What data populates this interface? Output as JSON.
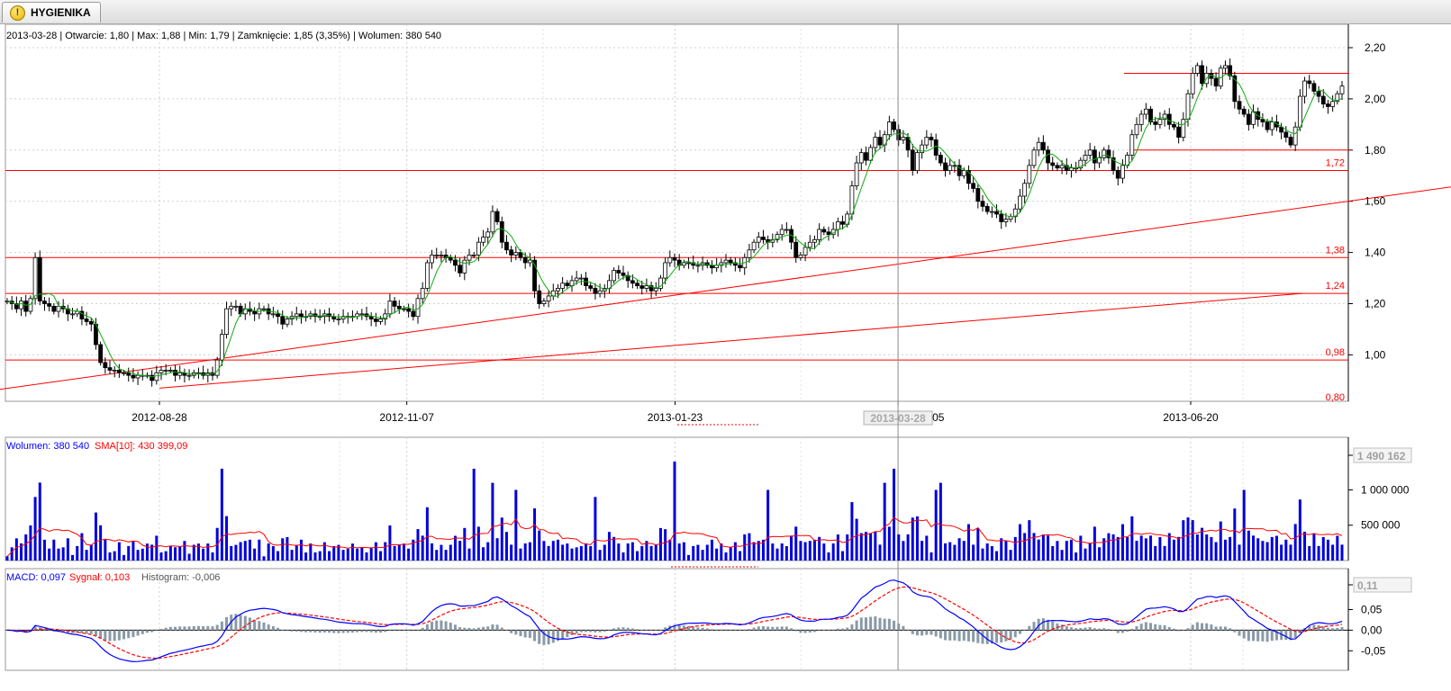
{
  "tab": {
    "title": "HYGIENIKA",
    "icon": "warning-icon"
  },
  "header": {
    "date": "2013-03-28",
    "info_text": "2013-03-28 | Otwarcie: 1,80 | Max: 1,88 | Min: 1,79 | Zamknięcie: 1,85 (3,35%)  | Wolumen: 380 540"
  },
  "volume_legend": {
    "volume": "Wolumen: 380 540",
    "sma": "SMA[10]: 430 399,09"
  },
  "macd_legend": {
    "macd": "MACD: 0,097",
    "signal": "Sygnał: 0,103",
    "histogram": "Histogram: -0,006"
  },
  "colors": {
    "up": "#ffffff",
    "down": "#000000",
    "sma_price": "#11aa11",
    "lines": "#ff0000",
    "volume": "#0000dd",
    "macd": "#0000ff",
    "signal": "#ff0000",
    "hist": "#8a9aa6"
  },
  "chart_data": [
    {
      "type": "candlestick",
      "title": "HYGIENIKA",
      "x_ticks": [
        "2012-08-28",
        "2012-11-07",
        "2013-01-23",
        "2013-03-28",
        "2013-06-20"
      ],
      "crosshair_date": "2013-03-28",
      "ylim": [
        0.84,
        2.22
      ],
      "y_ticks": [
        "2,20",
        "2,00",
        "1,80",
        "1,60",
        "1,40",
        "1,20",
        "1,00"
      ],
      "horizontal_levels": [
        {
          "value": 1.72,
          "label": "1,72"
        },
        {
          "value": 1.38,
          "label": "1,38"
        },
        {
          "value": 1.24,
          "label": "1,24"
        },
        {
          "value": 0.98,
          "label": "0,98"
        },
        {
          "value": 0.8,
          "label": "0,80"
        }
      ],
      "short_levels": [
        {
          "value": 2.1
        },
        {
          "value": 1.8
        }
      ],
      "trendlines": [
        {
          "from": [
            "2012-06-30",
            0.84
          ],
          "to": [
            "2013-09-10",
            1.67
          ]
        },
        {
          "from": [
            "2012-08-28",
            0.87
          ],
          "to": [
            "2013-07-22",
            1.24
          ]
        }
      ],
      "close": [
        1.21,
        1.2,
        1.18,
        1.21,
        1.17,
        1.22,
        1.38,
        1.21,
        1.2,
        1.19,
        1.17,
        1.19,
        1.18,
        1.16,
        1.16,
        1.17,
        1.14,
        1.13,
        1.12,
        1.04,
        0.97,
        0.95,
        0.94,
        0.94,
        0.93,
        0.93,
        0.92,
        0.91,
        0.92,
        0.92,
        0.92,
        0.9,
        0.93,
        0.94,
        0.94,
        0.94,
        0.92,
        0.93,
        0.92,
        0.92,
        0.93,
        0.93,
        0.92,
        0.93,
        0.92,
        0.98,
        1.08,
        1.18,
        1.19,
        1.19,
        1.16,
        1.18,
        1.17,
        1.16,
        1.18,
        1.18,
        1.16,
        1.16,
        1.15,
        1.12,
        1.14,
        1.15,
        1.16,
        1.15,
        1.15,
        1.16,
        1.15,
        1.15,
        1.16,
        1.15,
        1.14,
        1.14,
        1.15,
        1.15,
        1.15,
        1.16,
        1.16,
        1.15,
        1.14,
        1.13,
        1.14,
        1.16,
        1.21,
        1.19,
        1.18,
        1.18,
        1.17,
        1.15,
        1.22,
        1.26,
        1.36,
        1.39,
        1.39,
        1.39,
        1.38,
        1.37,
        1.35,
        1.32,
        1.37,
        1.39,
        1.39,
        1.44,
        1.46,
        1.48,
        1.56,
        1.52,
        1.44,
        1.41,
        1.39,
        1.4,
        1.38,
        1.36,
        1.37,
        1.25,
        1.2,
        1.21,
        1.23,
        1.25,
        1.26,
        1.28,
        1.27,
        1.29,
        1.3,
        1.3,
        1.27,
        1.26,
        1.24,
        1.25,
        1.26,
        1.29,
        1.33,
        1.32,
        1.31,
        1.29,
        1.28,
        1.27,
        1.26,
        1.27,
        1.25,
        1.26,
        1.3,
        1.36,
        1.38,
        1.37,
        1.35,
        1.36,
        1.36,
        1.35,
        1.35,
        1.36,
        1.35,
        1.34,
        1.35,
        1.36,
        1.37,
        1.36,
        1.35,
        1.34,
        1.38,
        1.41,
        1.44,
        1.46,
        1.45,
        1.44,
        1.45,
        1.47,
        1.49,
        1.49,
        1.44,
        1.38,
        1.39,
        1.42,
        1.44,
        1.45,
        1.49,
        1.48,
        1.47,
        1.49,
        1.52,
        1.51,
        1.55,
        1.66,
        1.75,
        1.79,
        1.76,
        1.81,
        1.85,
        1.82,
        1.86,
        1.91,
        1.88,
        1.84,
        1.85,
        1.8,
        1.72,
        1.79,
        1.82,
        1.85,
        1.84,
        1.78,
        1.75,
        1.72,
        1.74,
        1.74,
        1.7,
        1.72,
        1.67,
        1.65,
        1.6,
        1.58,
        1.56,
        1.56,
        1.55,
        1.52,
        1.53,
        1.54,
        1.57,
        1.62,
        1.67,
        1.74,
        1.8,
        1.83,
        1.8,
        1.75,
        1.74,
        1.73,
        1.74,
        1.72,
        1.73,
        1.73,
        1.76,
        1.78,
        1.8,
        1.75,
        1.77,
        1.8,
        1.77,
        1.72,
        1.69,
        1.74,
        1.78,
        1.86,
        1.9,
        1.94,
        1.96,
        1.91,
        1.9,
        1.92,
        1.94,
        1.9,
        1.89,
        1.85,
        1.92,
        2.02,
        2.1,
        2.13,
        2.06,
        2.1,
        2.08,
        2.05,
        2.12,
        2.13,
        2.09,
        1.99,
        1.96,
        1.94,
        1.9,
        1.95,
        1.92,
        1.91,
        1.88,
        1.91,
        1.89,
        1.87,
        1.85,
        1.82,
        1.89,
        2.01,
        2.07,
        2.06,
        2.03,
        2.01,
        1.98,
        1.97,
        1.99,
        2.02,
        2.05
      ]
    },
    {
      "type": "bar",
      "title": "Wolumen",
      "ylim": [
        0,
        1600000
      ],
      "y_ticks": [
        "1 490 162",
        "1 000 000",
        "500 000"
      ],
      "current_value": "1 490 162"
    },
    {
      "type": "line",
      "title": "MACD",
      "ylim": [
        -0.07,
        0.125
      ],
      "y_ticks": [
        "0,11",
        "0,05",
        "0,00",
        "-0,05"
      ],
      "current_value": "0,11"
    }
  ]
}
